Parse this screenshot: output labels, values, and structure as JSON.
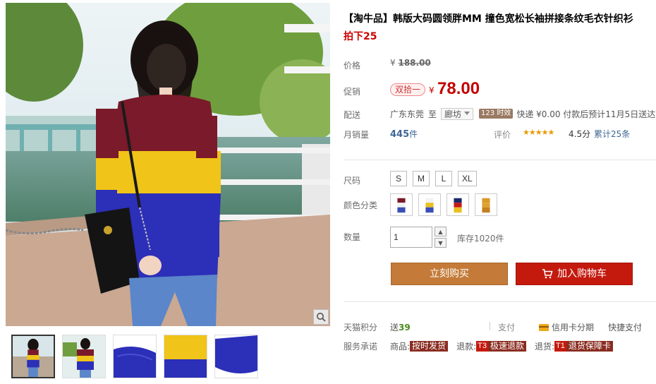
{
  "product": {
    "title": "【淘牛品】韩版大码圆领胖MM 撞色宽松长袖拼接条纹毛衣针织衫",
    "subtitle": "拍下25"
  },
  "price": {
    "label": "价格",
    "currency": "¥",
    "original": "188.00"
  },
  "promo": {
    "label": "促销",
    "badge": "双拾一",
    "currency": "¥",
    "price": "78.00"
  },
  "shipping": {
    "label": "配送",
    "from": "广东东莞",
    "to_word": "至",
    "destination": "廊坊",
    "service_tag": "123 时效",
    "text": "快递 ¥0.00 付款后预计11月5日送达"
  },
  "sales": {
    "label": "月销量",
    "count": "445",
    "unit": "件",
    "rating_label": "评价",
    "stars": "★★★★★",
    "score": "4.5分",
    "reviews": "累计25条"
  },
  "size": {
    "label": "尺码",
    "options": [
      "S",
      "M",
      "L",
      "XL"
    ]
  },
  "color": {
    "label": "颜色分类",
    "options": [
      {
        "name": "swatch-maroon-white-blue",
        "colors": [
          "#7a1a2a",
          "#f2f2f2",
          "#3a4fb5"
        ]
      },
      {
        "name": "swatch-white-yellow-blue",
        "colors": [
          "#f2f2f2",
          "#e8c020",
          "#3a4fb5"
        ]
      },
      {
        "name": "swatch-navy-red-yellow",
        "colors": [
          "#1a2a6a",
          "#c41a1a",
          "#e8c020"
        ]
      },
      {
        "name": "swatch-mustard-orange",
        "colors": [
          "#d99a2a",
          "#e0a030",
          "#c48020"
        ]
      }
    ]
  },
  "quantity": {
    "label": "数量",
    "value": "1",
    "up": "▲",
    "down": "▼",
    "stock": "库存1020件"
  },
  "actions": {
    "buy_now": "立刻购买",
    "add_cart": "加入购物车"
  },
  "tmall_points": {
    "label": "天猫积分",
    "prefix": "送",
    "value": "39",
    "pay_label": "支付",
    "credit": "信用卡分期",
    "quickpay": "快捷支付"
  },
  "service": {
    "label": "服务承诺",
    "goods_prefix": "商品:",
    "goods_tag": "按时发货",
    "refund_prefix": "退款:",
    "refund_code": "T3",
    "refund_tag": "极速退款",
    "return_prefix": "退货:",
    "return_code": "T1",
    "return_tag": "退货保障卡"
  },
  "icons": {
    "zoom": "magnifier-icon",
    "cart": "cart-icon"
  }
}
